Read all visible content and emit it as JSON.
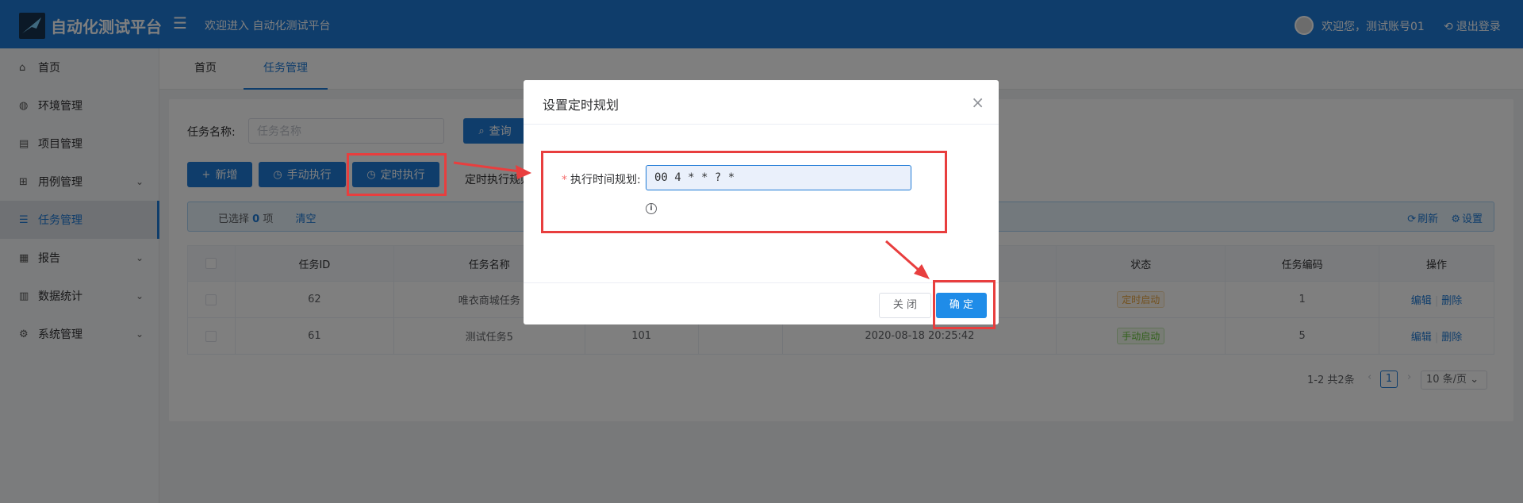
{
  "app": {
    "title": "自动化测试平台",
    "welcome_left": "欢迎进入 自动化测试平台",
    "welcome_right": "欢迎您，测试账号01",
    "logout": "退出登录"
  },
  "sidebar": {
    "items": [
      {
        "label": "首页",
        "icon": "home-icon",
        "has_children": false
      },
      {
        "label": "环境管理",
        "icon": "globe-icon",
        "has_children": false
      },
      {
        "label": "项目管理",
        "icon": "project-icon",
        "has_children": false
      },
      {
        "label": "用例管理",
        "icon": "hierarchy-icon",
        "has_children": true
      },
      {
        "label": "任务管理",
        "icon": "list-icon",
        "has_children": false,
        "active": true
      },
      {
        "label": "报告",
        "icon": "report-icon",
        "has_children": true
      },
      {
        "label": "数据统计",
        "icon": "chart-icon",
        "has_children": true
      },
      {
        "label": "系统管理",
        "icon": "gear-icon",
        "has_children": true
      }
    ]
  },
  "tabs": [
    {
      "label": "首页",
      "active": false
    },
    {
      "label": "任务管理",
      "active": true
    }
  ],
  "search": {
    "label": "任务名称:",
    "placeholder": "任务名称",
    "query_button": "查询"
  },
  "toolbar": {
    "add": "新增",
    "manual_run": "手动执行",
    "scheduled_run": "定时执行",
    "schedule_rule_text": "定时执行规则"
  },
  "alert": {
    "selected_prefix": "已选择",
    "selected_count": "0",
    "selected_suffix": "项",
    "clear": "清空",
    "refresh": "刷新",
    "settings": "设置"
  },
  "table": {
    "headers": [
      "任务ID",
      "任务名称",
      "",
      "",
      "",
      "状态",
      "任务编码",
      "操作"
    ],
    "rows": [
      {
        "id": "62",
        "name": "唯衣商城任务",
        "col3": "",
        "col4": "",
        "time": "",
        "status": "定时启动",
        "status_color": "#e6a23c",
        "code": "1",
        "edit": "编辑",
        "delete": "删除"
      },
      {
        "id": "61",
        "name": "测试任务5",
        "col3": "101",
        "col4": "",
        "time": "2020-08-18 20:25:42",
        "status": "手动启动",
        "status_color": "#67c23a",
        "code": "5",
        "edit": "编辑",
        "delete": "删除"
      }
    ]
  },
  "pagination": {
    "total": "1-2 共2条",
    "current_page": "1",
    "page_size": "10 条/页"
  },
  "modal": {
    "title": "设置定时规划",
    "field_label": "执行时间规划:",
    "field_value": "00 4 * * ? *",
    "close_button": "关 闭",
    "confirm_button": "确 定"
  },
  "colors": {
    "primary": "#1f7ad6",
    "highlight": "#e83e3e"
  }
}
